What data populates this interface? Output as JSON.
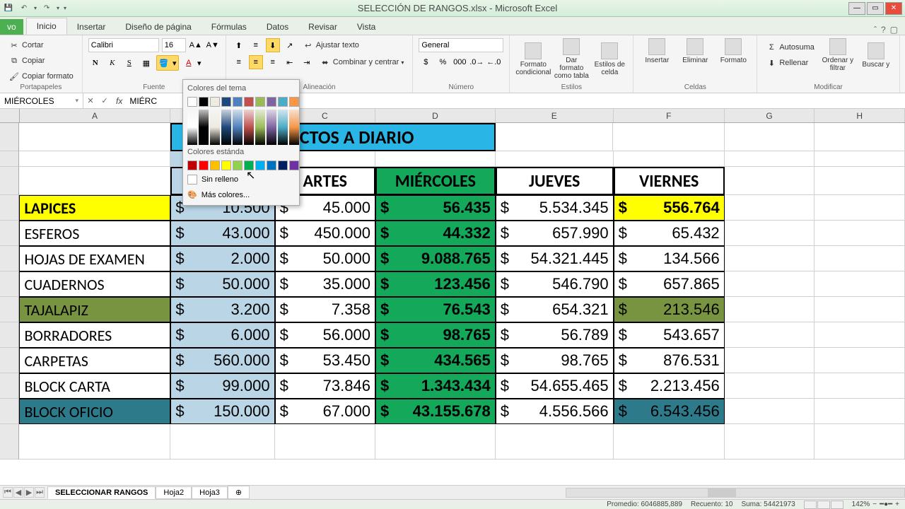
{
  "title": "SELECCIÓN DE RANGOS.xlsx - Microsoft Excel",
  "tabs": {
    "file": "vo",
    "list": [
      "Inicio",
      "Insertar",
      "Diseño de página",
      "Fórmulas",
      "Datos",
      "Revisar",
      "Vista"
    ],
    "active": 0
  },
  "clipboard": {
    "cut": "Cortar",
    "copy": "Copiar",
    "paint": "Copiar formato",
    "label": "Portapapeles"
  },
  "font": {
    "name": "Calibri",
    "size": "16",
    "bold": "N",
    "italic": "K",
    "underline": "S",
    "label": "Fuente"
  },
  "align": {
    "wrap": "Ajustar texto",
    "merge": "Combinar y centrar",
    "label": "Alineación"
  },
  "number": {
    "format": "General",
    "label": "Número"
  },
  "styles": {
    "cond": "Formato condicional",
    "table": "Dar formato como tabla",
    "cell": "Estilos de celda",
    "label": "Estilos"
  },
  "cells": {
    "insert": "Insertar",
    "delete": "Eliminar",
    "format": "Formato",
    "label": "Celdas"
  },
  "edit": {
    "sum": "Autosuma",
    "fill": "Rellenar",
    "sort": "Ordenar y filtrar",
    "find": "Buscar y",
    "label": "Modificar"
  },
  "name_box": "MIÉRCOLES",
  "formula_value": "MIÉRC",
  "fx": "fx",
  "columns": [
    "A",
    "B",
    "C",
    "D",
    "E",
    "F",
    "G",
    "H"
  ],
  "popup": {
    "theme": "Colores del tema",
    "standard": "Colores estánda",
    "nofill": "Sin relleno",
    "more": "Más colores..."
  },
  "merged_title_partial": "VE                       DUCTOS A DIARIO",
  "header_row": [
    "",
    "",
    "ARTES",
    "MIÉRCOLES",
    "JUEVES",
    "VIERNES"
  ],
  "data": [
    {
      "name": "LAPICES",
      "bg": "yellow",
      "b": "10.500",
      "c": "45.000",
      "d": "56.435",
      "e": "5.534.345",
      "f": "556.764"
    },
    {
      "name": "ESFEROS",
      "bg": "",
      "b": "43.000",
      "c": "450.000",
      "d": "44.332",
      "e": "657.990",
      "f": "65.432"
    },
    {
      "name": "HOJAS DE EXAMEN",
      "bg": "",
      "b": "2.000",
      "c": "50.000",
      "d": "9.088.765",
      "e": "54.321.445",
      "f": "134.566"
    },
    {
      "name": "CUADERNOS",
      "bg": "",
      "b": "50.000",
      "c": "35.000",
      "d": "123.456",
      "e": "546.790",
      "f": "657.865"
    },
    {
      "name": "TAJALAPIZ",
      "bg": "olive",
      "b": "3.200",
      "c": "7.358",
      "d": "76.543",
      "e": "654.321",
      "f": "213.546"
    },
    {
      "name": "BORRADORES",
      "bg": "",
      "b": "6.000",
      "c": "56.000",
      "d": "98.765",
      "e": "56.789",
      "f": "543.657"
    },
    {
      "name": "CARPETAS",
      "bg": "",
      "b": "560.000",
      "c": "53.450",
      "d": "434.565",
      "e": "98.765",
      "f": "876.531"
    },
    {
      "name": "BLOCK CARTA",
      "bg": "",
      "b": "99.000",
      "c": "73.846",
      "d": "1.343.434",
      "e": "54.655.465",
      "f": "2.213.456"
    },
    {
      "name": "BLOCK OFICIO",
      "bg": "teal",
      "b": "150.000",
      "c": "67.000",
      "d": "43.155.678",
      "e": "4.556.566",
      "f": "6.543.456"
    }
  ],
  "sheets": [
    "SELECCIONAR RANGOS",
    "Hoja2",
    "Hoja3"
  ],
  "status": {
    "avg_label": "Promedio:",
    "avg": "6046885,889",
    "count_label": "Recuento:",
    "count": "10",
    "sum_label": "Suma:",
    "sum": "54421973",
    "zoom": "142%"
  },
  "theme_colors": [
    "#ffffff",
    "#000000",
    "#eeece1",
    "#1f497d",
    "#4f81bd",
    "#c0504d",
    "#9bbb59",
    "#8064a2",
    "#4bacc6",
    "#f79646"
  ],
  "std_colors": [
    "#c00000",
    "#ff0000",
    "#ffc000",
    "#ffff00",
    "#92d050",
    "#00b050",
    "#00b0f0",
    "#0070c0",
    "#002060",
    "#7030a0"
  ]
}
